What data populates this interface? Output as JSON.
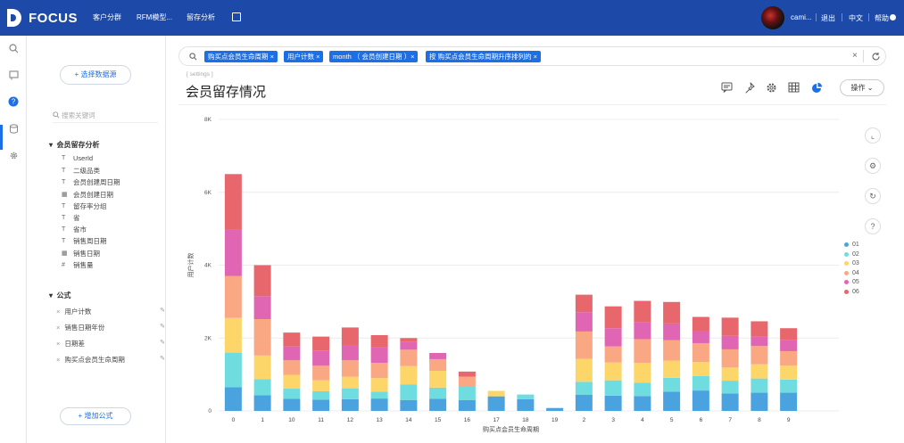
{
  "app": {
    "name": "FOCUS"
  },
  "nav": {
    "items": [
      "客户分群",
      "RFM模型...",
      "留存分析"
    ]
  },
  "top_right": {
    "user": "cami...",
    "logout": "退出",
    "lang": "中文",
    "help": "帮助"
  },
  "sidebar": {
    "select_datasource": "+ 选择数据源",
    "search_placeholder": "搜索关键词",
    "section_title": "会员留存分析",
    "fields": [
      {
        "label": "UserId",
        "icon": "text-type-icon"
      },
      {
        "label": "二级品类",
        "icon": "text-type-icon"
      },
      {
        "label": "会员创建周日期",
        "icon": "text-type-icon"
      },
      {
        "label": "会员创建日期",
        "icon": "date-type-icon"
      },
      {
        "label": "留存率分组",
        "icon": "text-type-icon"
      },
      {
        "label": "省",
        "icon": "text-type-icon"
      },
      {
        "label": "省市",
        "icon": "text-type-icon"
      },
      {
        "label": "销售周日期",
        "icon": "text-type-icon"
      },
      {
        "label": "销售日期",
        "icon": "date-type-icon"
      },
      {
        "label": "销售量",
        "icon": "number-type-icon"
      }
    ],
    "formula_title": "公式",
    "formulas": [
      "用户计数",
      "销售日期年份",
      "日期差",
      "购买点会员生命周期"
    ],
    "add_formula": "+ 增加公式"
  },
  "query": {
    "chips": [
      "购买点会员生命周期 ×",
      "用户计数 ×",
      "month （ 会员创建日期 ）×",
      "按    购买点会员生命周期升序排列的 ×"
    ]
  },
  "chart_header": {
    "subtitle": "[ settings ]",
    "title": "会员留存情况",
    "op_button": "操作"
  },
  "colors": {
    "primary": "#1d4aa8",
    "accent": "#1d6fe6"
  },
  "chart_data": {
    "type": "bar",
    "stacked": true,
    "xlabel": "购买点会员生命周期",
    "ylabel": "用户计数",
    "ylim": [
      0,
      8000
    ],
    "yticks": [
      "0",
      "2K",
      "4K",
      "6K",
      "8K"
    ],
    "ytick_values": [
      0,
      2000,
      4000,
      6000,
      8000
    ],
    "categories": [
      "0",
      "1",
      "10",
      "11",
      "12",
      "13",
      "14",
      "15",
      "16",
      "17",
      "18",
      "19",
      "2",
      "3",
      "4",
      "5",
      "6",
      "7",
      "8",
      "9"
    ],
    "series": [
      {
        "name": "01",
        "color": "#4aa3df",
        "values": [
          650,
          430,
          330,
          310,
          320,
          340,
          300,
          330,
          300,
          400,
          320,
          80,
          440,
          420,
          410,
          530,
          560,
          480,
          500,
          500
        ]
      },
      {
        "name": "02",
        "color": "#6fdde0",
        "values": [
          950,
          440,
          280,
          230,
          300,
          190,
          430,
          310,
          360,
          0,
          130,
          0,
          360,
          420,
          360,
          380,
          400,
          350,
          390,
          360
        ]
      },
      {
        "name": "03",
        "color": "#fcd669",
        "values": [
          950,
          650,
          380,
          300,
          320,
          370,
          500,
          460,
          0,
          150,
          0,
          0,
          630,
          490,
          550,
          470,
          380,
          360,
          390,
          380
        ]
      },
      {
        "name": "04",
        "color": "#f9a883",
        "values": [
          1150,
          1000,
          400,
          400,
          450,
          420,
          450,
          320,
          280,
          0,
          0,
          0,
          750,
          440,
          650,
          560,
          520,
          500,
          500,
          400
        ]
      },
      {
        "name": "05",
        "color": "#e066b3",
        "values": [
          1280,
          630,
          380,
          420,
          420,
          440,
          210,
          170,
          0,
          0,
          0,
          0,
          530,
          500,
          460,
          460,
          330,
          370,
          260,
          300
        ]
      },
      {
        "name": "06",
        "color": "#e8676c",
        "values": [
          1520,
          850,
          380,
          380,
          480,
          320,
          110,
          0,
          140,
          0,
          0,
          0,
          480,
          600,
          590,
          590,
          390,
          500,
          420,
          330
        ]
      }
    ],
    "legend_position": "right"
  }
}
